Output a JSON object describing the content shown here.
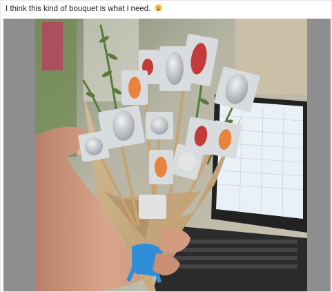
{
  "post": {
    "caption": "I think this kind of bouquet is what i need.",
    "emoji": "weary-face-emoji"
  },
  "photo": {
    "subject": "pill-bouquet-photo",
    "laptop_screen_color": "#e9f1f6",
    "wrapping_paper_color": "#c9ab7e",
    "ribbon_color": "#2f8fd6",
    "fern_color": "#5a7a3a",
    "capsule_red": "#c23a3a",
    "tablet_orange": "#e8843e"
  }
}
